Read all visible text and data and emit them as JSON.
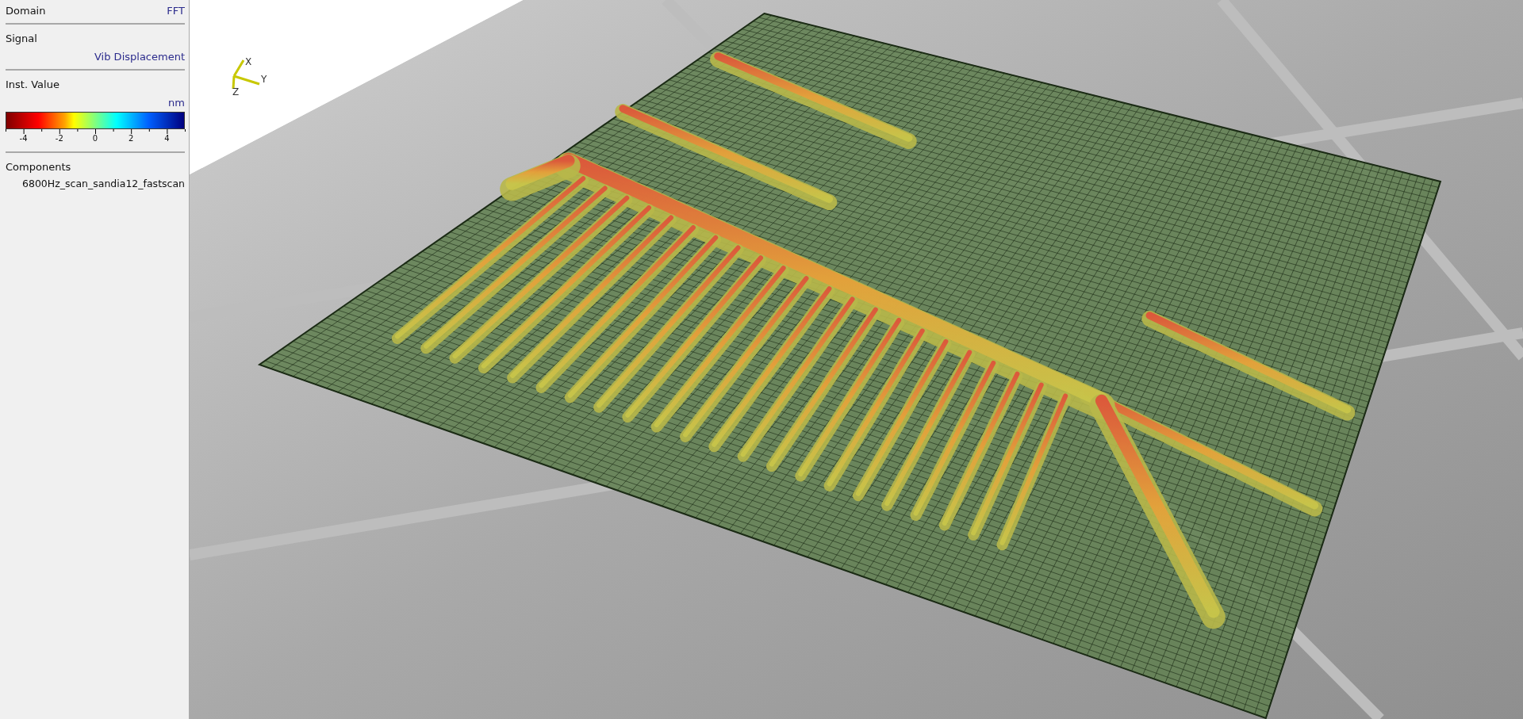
{
  "panel": {
    "domain": {
      "label": "Domain",
      "value": "FFT"
    },
    "signal": {
      "label": "Signal",
      "value": "Vib Displacement"
    },
    "inst_value": {
      "label": "Inst. Value",
      "unit": "nm",
      "ticks": [
        "-4",
        "-2",
        "0",
        "2",
        "4"
      ]
    },
    "components": {
      "label": "Components",
      "items": [
        "6800Hz_scan_sandia12_fastscan"
      ]
    }
  },
  "viewport": {
    "axes": [
      "X",
      "Y",
      "Z"
    ]
  }
}
